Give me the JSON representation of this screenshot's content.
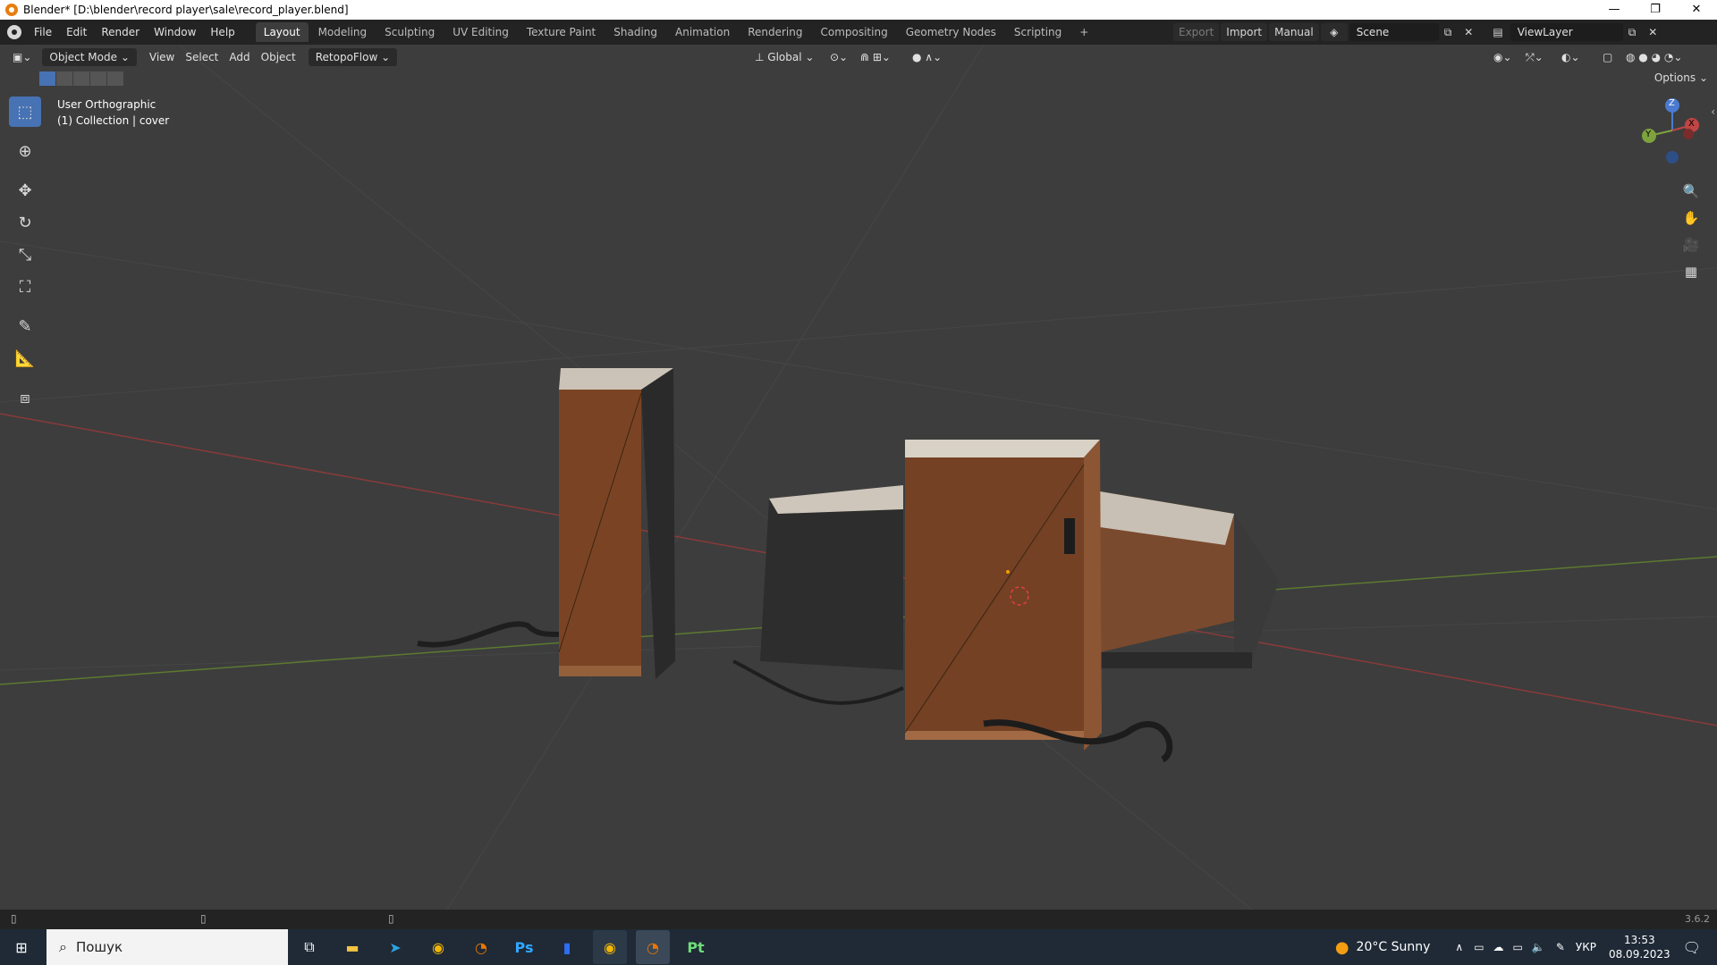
{
  "window": {
    "title": "Blender* [D:\\blender\\record player\\sale\\record_player.blend]",
    "min": "—",
    "max": "❐",
    "close": "✕"
  },
  "menu": {
    "items": [
      "File",
      "Edit",
      "Render",
      "Window",
      "Help"
    ]
  },
  "workspaces": {
    "tabs": [
      "Layout",
      "Modeling",
      "Sculpting",
      "UV Editing",
      "Texture Paint",
      "Shading",
      "Animation",
      "Rendering",
      "Compositing",
      "Geometry Nodes",
      "Scripting"
    ],
    "active": "Layout",
    "add": "+"
  },
  "topright": {
    "export": "Export",
    "import": "Import",
    "manual": "Manual",
    "scene": "Scene",
    "view_layer": "ViewLayer"
  },
  "viewport_header": {
    "mode": "Object Mode",
    "menus": [
      "View",
      "Select",
      "Add",
      "Object"
    ],
    "addon": "RetopoFlow",
    "orientation": "Global",
    "options": "Options"
  },
  "overlay": {
    "view_name": "User Orthographic",
    "collection": "(1) Collection | cover"
  },
  "gizmo": {
    "z": "Z",
    "y": "Y",
    "x": "X"
  },
  "statusbar": {
    "version": "3.6.2"
  },
  "taskbar": {
    "search_placeholder": "Пошук",
    "weather": "20°C  Sunny",
    "lang": "УКР",
    "time": "13:53",
    "date": "08.09.2023"
  },
  "colors": {
    "accent": "#4772b3",
    "x_axis": "#c14545",
    "y_axis": "#7ea33d",
    "z_axis": "#4a7bd1"
  }
}
